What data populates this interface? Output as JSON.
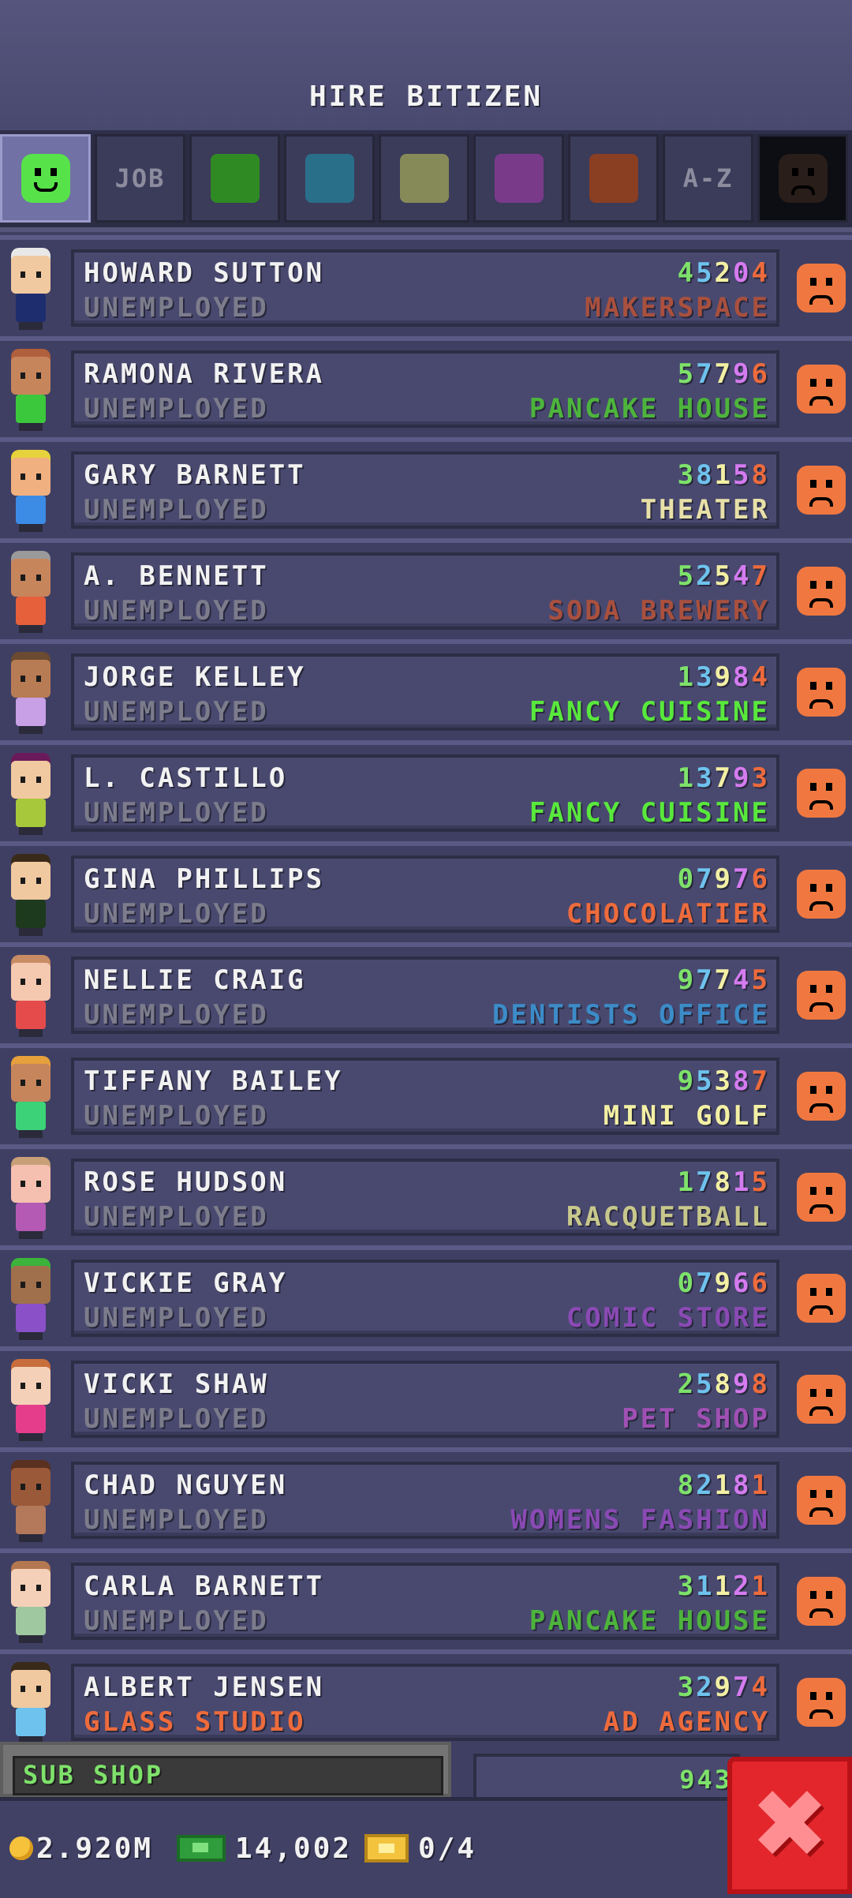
{
  "header": {
    "title": "HIRE BITIZEN"
  },
  "filters": [
    {
      "type": "icon",
      "name": "happy-face",
      "color": "#58e24a",
      "selected": true
    },
    {
      "type": "text",
      "label": "JOB"
    },
    {
      "type": "swatch",
      "color": "#2f8a24"
    },
    {
      "type": "swatch",
      "color": "#2a6f8a"
    },
    {
      "type": "swatch",
      "color": "#868a58"
    },
    {
      "type": "swatch",
      "color": "#7a3a8a"
    },
    {
      "type": "swatch",
      "color": "#8a3e22"
    },
    {
      "type": "text",
      "label": "A-Z"
    },
    {
      "type": "icon",
      "name": "sad-face",
      "color": "#2a1e1a",
      "dark": true
    }
  ],
  "digit_colors": [
    "#7ee26a",
    "#6ec3ee",
    "#f3f0a4",
    "#d57bf0",
    "#ee6b3c"
  ],
  "bitizens": [
    {
      "name": "HOWARD SUTTON",
      "job": "UNEMPLOYED",
      "code": "45204",
      "dream_job": "MAKERSPACE",
      "dream_color": "#a9503e",
      "avatar": {
        "hair": "#e8e8e8",
        "skin": "#f0c9a0",
        "shirt": "#1e2d6e"
      }
    },
    {
      "name": "RAMONA RIVERA",
      "job": "UNEMPLOYED",
      "code": "57796",
      "dream_job": "PANCAKE HOUSE",
      "dream_color": "#4db43c",
      "avatar": {
        "hair": "#b0603c",
        "skin": "#c7855c",
        "shirt": "#3cc83c"
      }
    },
    {
      "name": "GARY BARNETT",
      "job": "UNEMPLOYED",
      "code": "38158",
      "dream_job": "THEATER",
      "dream_color": "#e8e0a8",
      "avatar": {
        "hair": "#e6d23c",
        "skin": "#f0b080",
        "shirt": "#3c8ce6"
      }
    },
    {
      "name": "A. BENNETT",
      "job": "UNEMPLOYED",
      "code": "52547",
      "dream_job": "SODA BREWERY",
      "dream_color": "#a9503e",
      "avatar": {
        "hair": "#9a9a9a",
        "skin": "#c7855c",
        "shirt": "#e6603c"
      }
    },
    {
      "name": "JORGE KELLEY",
      "job": "UNEMPLOYED",
      "code": "13984",
      "dream_job": "FANCY CUISINE",
      "dream_color": "#59e83c",
      "avatar": {
        "hair": "#6a4a30",
        "skin": "#b87c54",
        "shirt": "#c8a0e6"
      }
    },
    {
      "name": "L. CASTILLO",
      "job": "UNEMPLOYED",
      "code": "13793",
      "dream_job": "FANCY CUISINE",
      "dream_color": "#59e83c",
      "avatar": {
        "hair": "#6a1a5a",
        "skin": "#f0c9a0",
        "shirt": "#a8c83c"
      }
    },
    {
      "name": "GINA PHILLIPS",
      "job": "UNEMPLOYED",
      "code": "07976",
      "dream_job": "CHOCOLATIER",
      "dream_color": "#ee6b3c",
      "avatar": {
        "hair": "#3a2a1a",
        "skin": "#f0c9a0",
        "shirt": "#1e3a1e"
      }
    },
    {
      "name": "NELLIE CRAIG",
      "job": "UNEMPLOYED",
      "code": "97745",
      "dream_job": "DENTISTS OFFICE",
      "dream_color": "#3c8cc8",
      "avatar": {
        "hair": "#c88c64",
        "skin": "#f5c8b0",
        "shirt": "#e64b4b"
      }
    },
    {
      "name": "TIFFANY BAILEY",
      "job": "UNEMPLOYED",
      "code": "95387",
      "dream_job": "MINI GOLF",
      "dream_color": "#f3f0a4",
      "avatar": {
        "hair": "#e6a03c",
        "skin": "#c7855c",
        "shirt": "#3cd278"
      }
    },
    {
      "name": "ROSE HUDSON",
      "job": "UNEMPLOYED",
      "code": "17815",
      "dream_job": "RACQUETBALL",
      "dream_color": "#c8c88c",
      "avatar": {
        "hair": "#c8a078",
        "skin": "#f5c0b0",
        "shirt": "#b45ab4"
      }
    },
    {
      "name": "VICKIE GRAY",
      "job": "UNEMPLOYED",
      "code": "07966",
      "dream_job": "COMIC STORE",
      "dream_color": "#8a4ab4",
      "avatar": {
        "hair": "#3cb43c",
        "skin": "#a0704c",
        "shirt": "#8a50c8"
      }
    },
    {
      "name": "VICKI SHAW",
      "job": "UNEMPLOYED",
      "code": "25898",
      "dream_job": "PET SHOP",
      "dream_color": "#a050b4",
      "avatar": {
        "hair": "#c86e3c",
        "skin": "#f5d0b8",
        "shirt": "#e63c8c"
      }
    },
    {
      "name": "CHAD NGUYEN",
      "job": "UNEMPLOYED",
      "code": "82181",
      "dream_job": "WOMENS FASHION",
      "dream_color": "#8a4ab4",
      "avatar": {
        "hair": "#5a3020",
        "skin": "#9a5a3a",
        "shirt": "#b4785a"
      }
    },
    {
      "name": "CARLA BARNETT",
      "job": "UNEMPLOYED",
      "code": "31121",
      "dream_job": "PANCAKE HOUSE",
      "dream_color": "#4db43c",
      "avatar": {
        "hair": "#b47850",
        "skin": "#f5d0b8",
        "shirt": "#a0c8a0"
      }
    },
    {
      "name": "ALBERT JENSEN",
      "job": "GLASS STUDIO",
      "employed": true,
      "code": "32974",
      "dream_job": "AD AGENCY",
      "dream_color": "#ee6b3c",
      "avatar": {
        "hair": "#3a2a1a",
        "skin": "#f0c9a0",
        "shirt": "#6ec3ee"
      }
    }
  ],
  "partial_row": {
    "code": "943"
  },
  "sub_shop": {
    "label": "SUB SHOP"
  },
  "bottom": {
    "coins": "2.920M",
    "bux": "14,002",
    "tickets": "0/4"
  },
  "close": {
    "glyph": "✖"
  }
}
